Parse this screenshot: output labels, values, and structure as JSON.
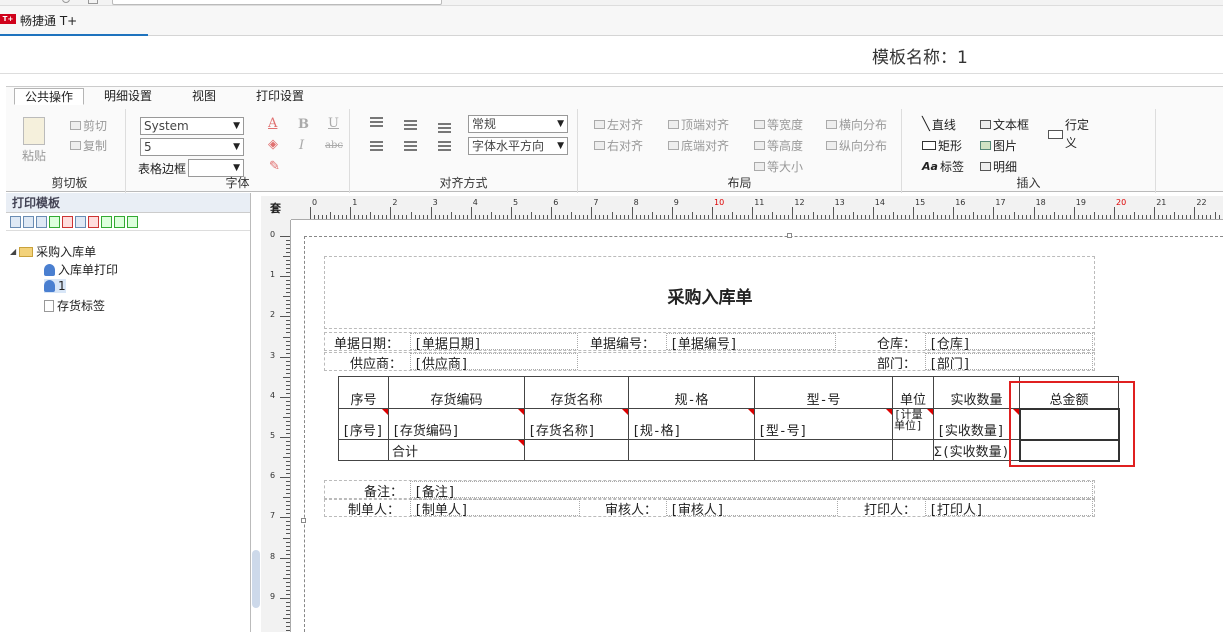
{
  "app": {
    "name": "畅捷通 T+",
    "logo_text": "T+"
  },
  "template_title": "模板名称：1",
  "ribbon": {
    "tabs": [
      "公共操作",
      "明细设置",
      "视图",
      "打印设置"
    ],
    "active_tab": "公共操作",
    "clipboard": {
      "paste": "粘贴",
      "cut": "剪切",
      "copy": "复制",
      "label": "剪切板"
    },
    "font": {
      "family": "System",
      "size": "5",
      "border_label": "表格边框",
      "label": "字体",
      "bold": "B",
      "italic": "I",
      "underline": "U",
      "strike": "abc",
      "color_a": "A"
    },
    "align": {
      "style": "常规",
      "halign": "字体水平方向",
      "label": "对齐方式"
    },
    "layout": {
      "items": [
        "左对齐",
        "顶端对齐",
        "等宽度",
        "横向分布",
        "右对齐",
        "底端对齐",
        "等高度",
        "纵向分布",
        "等大小"
      ],
      "label": "布局"
    },
    "insert": {
      "line": "直线",
      "textbox": "文本框",
      "custom_row": "行定义",
      "rect": "矩形",
      "image": "图片",
      "label_item": "标签",
      "detail": "明细",
      "label": "插入"
    }
  },
  "left_panel": {
    "title": "打印模板",
    "tree": [
      {
        "label": "采购入库单",
        "type": "folder"
      },
      {
        "label": "入库单打印",
        "type": "user"
      },
      {
        "label": "1",
        "type": "user"
      },
      {
        "label": "存货标签",
        "type": "page"
      }
    ]
  },
  "ruler": {
    "corner": "套",
    "h_labels": [
      "0",
      "1",
      "2",
      "3",
      "4",
      "5",
      "6",
      "7",
      "8",
      "9",
      "10",
      "11",
      "12",
      "13",
      "14",
      "15",
      "16",
      "17",
      "18",
      "19",
      "20",
      "21",
      "22"
    ],
    "v_labels": [
      "0",
      "1",
      "2",
      "3",
      "4",
      "5",
      "6",
      "7",
      "8",
      "9"
    ]
  },
  "report": {
    "title": "采购入库单",
    "header_fields": [
      {
        "label": "单据日期：",
        "value": "[单据日期]"
      },
      {
        "label": "单据编号：",
        "value": "[单据编号]"
      },
      {
        "label": "仓库：",
        "value": "[仓库]"
      },
      {
        "label": "供应商：",
        "value": "[供应商]"
      },
      {
        "label": "部门：",
        "value": "[部门]"
      }
    ],
    "columns": [
      "序号",
      "存货编码",
      "存货名称",
      "规-格",
      "型-号",
      "单位",
      "实收数量",
      "总金额"
    ],
    "detail_row": [
      "[序号]",
      "[存货编码]",
      "[存货名称]",
      "[规-格]",
      "[型-号]",
      "[计量单位]",
      "[实收数量]",
      ""
    ],
    "unit_line1": "[计量",
    "unit_line2": "单位]",
    "sum_row": {
      "label": "合计",
      "qty": "Σ(实收数量)"
    },
    "footer_fields": [
      {
        "label": "备注：",
        "value": "[备注]"
      },
      {
        "label": "制单人：",
        "value": "[制单人]"
      },
      {
        "label": "审核人：",
        "value": "[审核人]"
      },
      {
        "label": "打印人：",
        "value": "[打印人]"
      }
    ]
  },
  "colors": {
    "accent": "#1e73be",
    "highlight": "#e02020",
    "marker": "#dd0000"
  }
}
